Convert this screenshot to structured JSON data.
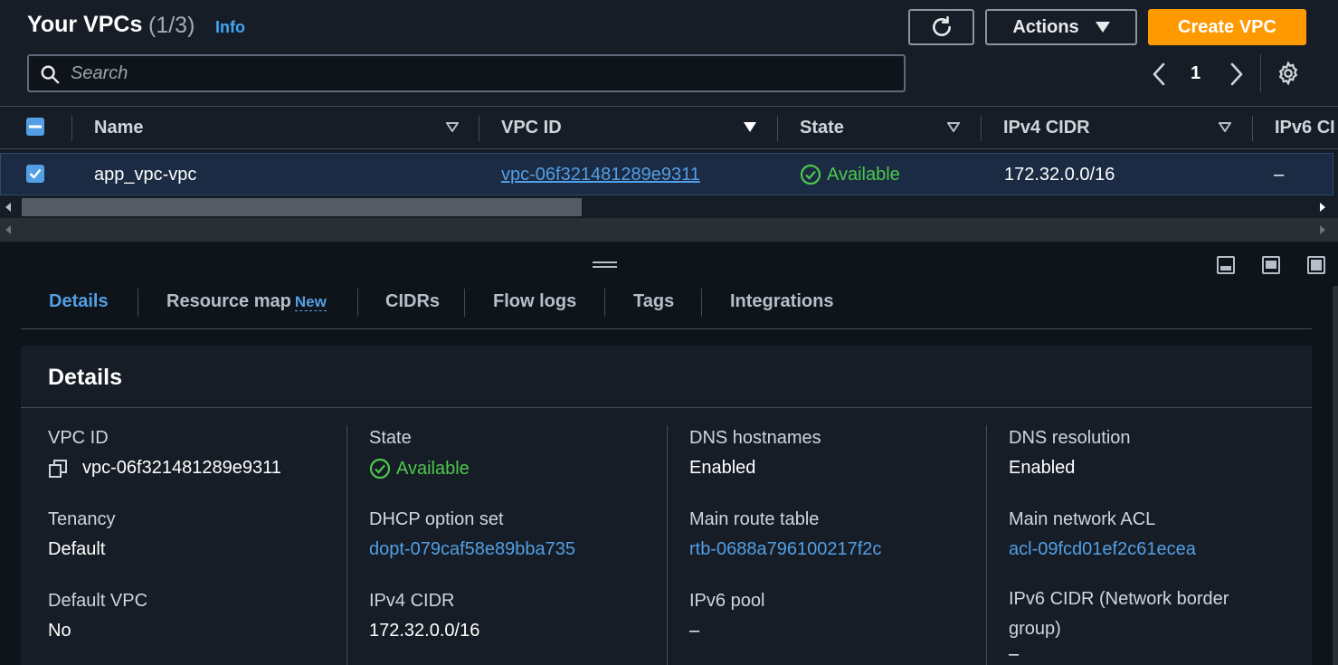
{
  "header": {
    "title": "Your VPCs",
    "count": "(1/3)",
    "info": "Info",
    "actions_label": "Actions",
    "create_label": "Create VPC"
  },
  "search": {
    "placeholder": "Search"
  },
  "pagination": {
    "current_page": "1"
  },
  "table": {
    "columns": [
      "Name",
      "VPC ID",
      "State",
      "IPv4 CIDR",
      "IPv6 CI"
    ],
    "rows": [
      {
        "name": "app_vpc-vpc",
        "vpc_id": "vpc-06f321481289e9311",
        "state": "Available",
        "ipv4_cidr": "172.32.0.0/16",
        "ipv6_cidr": "–"
      }
    ]
  },
  "tabs": [
    {
      "label": "Details",
      "active": true
    },
    {
      "label": "Resource map",
      "badge": "New"
    },
    {
      "label": "CIDRs"
    },
    {
      "label": "Flow logs"
    },
    {
      "label": "Tags"
    },
    {
      "label": "Integrations"
    }
  ],
  "details": {
    "title": "Details",
    "col1": [
      {
        "key": "VPC ID",
        "value": "vpc-06f321481289e9311"
      },
      {
        "key": "Tenancy",
        "value": "Default"
      },
      {
        "key": "Default VPC",
        "value": "No"
      }
    ],
    "col2": [
      {
        "key": "State",
        "value": "Available"
      },
      {
        "key": "DHCP option set",
        "value": "dopt-079caf58e89bba735"
      },
      {
        "key": "IPv4 CIDR",
        "value": "172.32.0.0/16"
      }
    ],
    "col3": [
      {
        "key": "DNS hostnames",
        "value": "Enabled"
      },
      {
        "key": "Main route table",
        "value": "rtb-0688a796100217f2c"
      },
      {
        "key": "IPv6 pool",
        "value": "–"
      }
    ],
    "col4": [
      {
        "key": "DNS resolution",
        "value": "Enabled"
      },
      {
        "key": "Main network ACL",
        "value": "acl-09fcd01ef2c61ecea"
      },
      {
        "key": "IPv6 CIDR (Network border group)",
        "value": "–"
      }
    ]
  },
  "colors": {
    "accent": "#539fe5",
    "primary_button": "#ff9900",
    "success": "#4ec64e",
    "background": "#161d26"
  }
}
